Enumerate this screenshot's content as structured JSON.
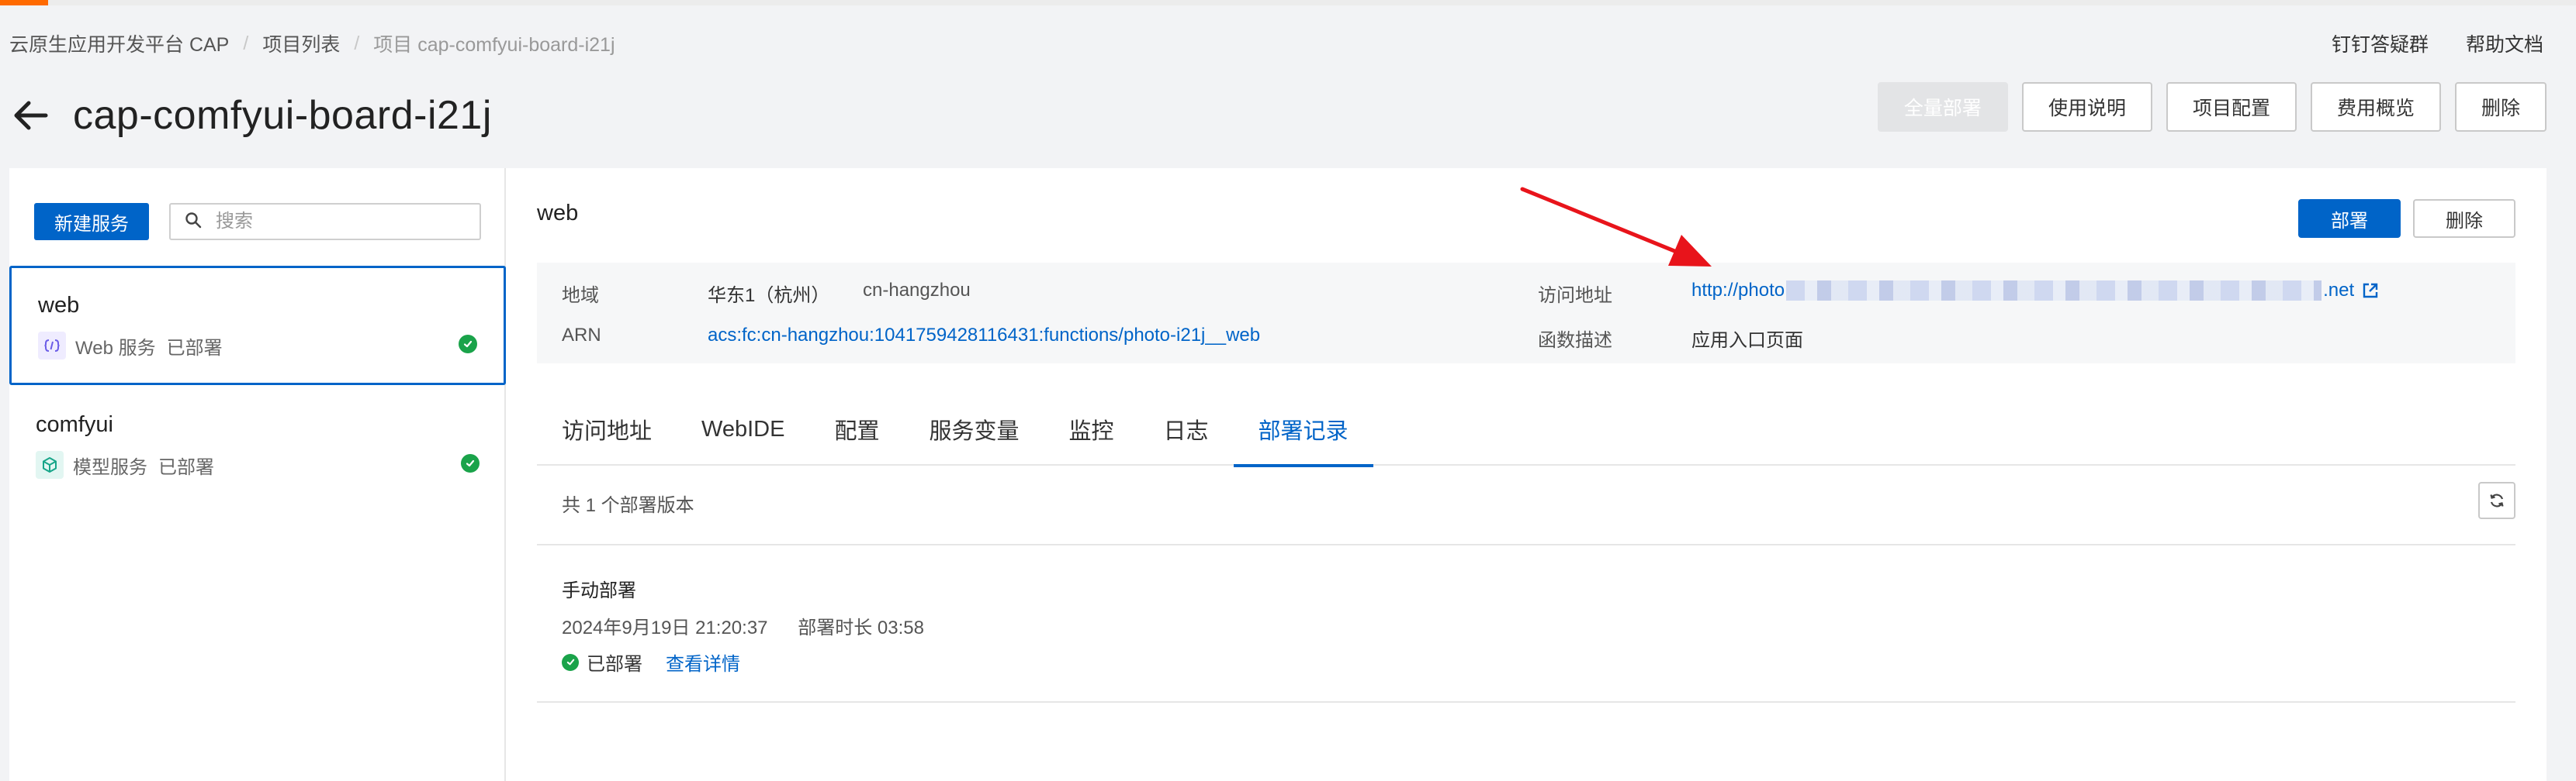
{
  "breadcrumb": {
    "root": "云原生应用开发平台 CAP",
    "projects": "项目列表",
    "current": "项目 cap-comfyui-board-i21j"
  },
  "top_links": {
    "dingtalk": "钉钉答疑群",
    "help": "帮助文档"
  },
  "page": {
    "title": "cap-comfyui-board-i21j"
  },
  "top_actions": {
    "deploy_all": "全量部署",
    "usage": "使用说明",
    "project_config": "项目配置",
    "cost": "费用概览",
    "delete": "删除"
  },
  "sidebar": {
    "new_service": "新建服务",
    "search_placeholder": "搜索",
    "items": [
      {
        "name": "web",
        "type": "Web 服务",
        "status": "已部署",
        "icon": "web-service-icon"
      },
      {
        "name": "comfyui",
        "type": "模型服务",
        "status": "已部署",
        "icon": "model-service-icon"
      }
    ]
  },
  "service": {
    "title": "web",
    "deploy_label": "部署",
    "delete_label": "删除",
    "info": {
      "region_label": "地域",
      "region_value": "华东1（杭州）",
      "region_code": "cn-hangzhou",
      "arn_label": "ARN",
      "arn_value": "acs:fc:cn-hangzhou:1041759428116431:functions/photo-i21j__web",
      "url_label": "访问地址",
      "url_prefix": "http://photo",
      "url_suffix": ".net",
      "desc_label": "函数描述",
      "desc_value": "应用入口页面"
    }
  },
  "tabs": [
    "访问地址",
    "WebIDE",
    "配置",
    "服务变量",
    "监控",
    "日志",
    "部署记录"
  ],
  "active_tab": "部署记录",
  "records": {
    "count_text": "共 1 个部署版本",
    "items": [
      {
        "type": "手动部署",
        "time": "2024年9月19日 21:20:37",
        "duration": "部署时长 03:58",
        "status": "已部署",
        "detail": "查看详情"
      }
    ]
  },
  "colors": {
    "brand": "#ff6a00",
    "primary": "#0064c8",
    "success": "#1aa34a",
    "annotation_arrow": "#e8141b"
  }
}
